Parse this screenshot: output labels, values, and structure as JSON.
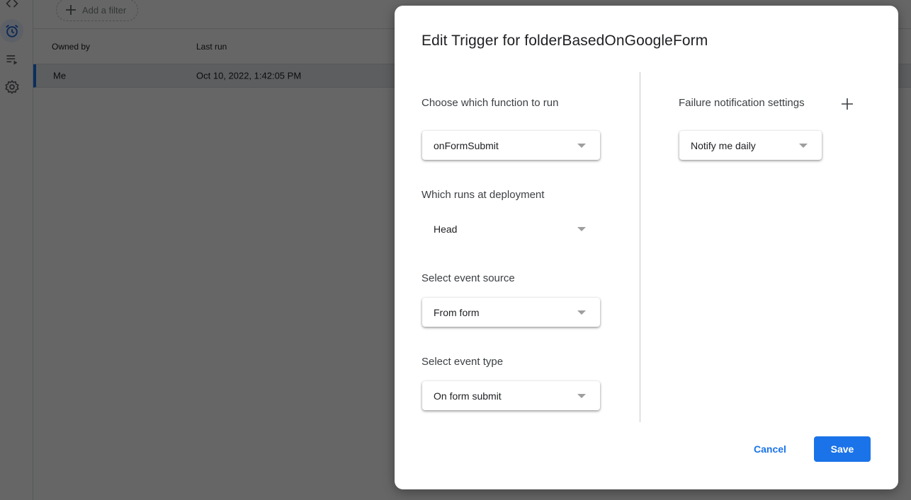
{
  "background": {
    "filter": {
      "add_filter_label": "Add a filter"
    },
    "table": {
      "columns": [
        "Owned by",
        "Last run"
      ],
      "rows": [
        {
          "owned_by": "Me",
          "last_run": "Oct 10, 2022, 1:42:05 PM"
        }
      ]
    },
    "rail": {
      "items": [
        {
          "icon": "code-icon"
        },
        {
          "icon": "alarm-clock-icon",
          "active": true
        },
        {
          "icon": "executions-icon"
        },
        {
          "icon": "gear-icon"
        }
      ]
    }
  },
  "dialog": {
    "title": "Edit Trigger for folderBasedOnGoogleForm",
    "left": {
      "function_label": "Choose which function to run",
      "function_value": "onFormSubmit",
      "deployment_label": "Which runs at deployment",
      "deployment_value": "Head",
      "event_source_label": "Select event source",
      "event_source_value": "From form",
      "event_type_label": "Select event type",
      "event_type_value": "On form submit"
    },
    "right": {
      "failure_label": "Failure notification settings",
      "failure_value": "Notify me daily"
    },
    "actions": {
      "cancel": "Cancel",
      "save": "Save"
    }
  },
  "colors": {
    "primary": "#1a73e8",
    "overlay": "rgba(0,0,0,0.6)"
  }
}
